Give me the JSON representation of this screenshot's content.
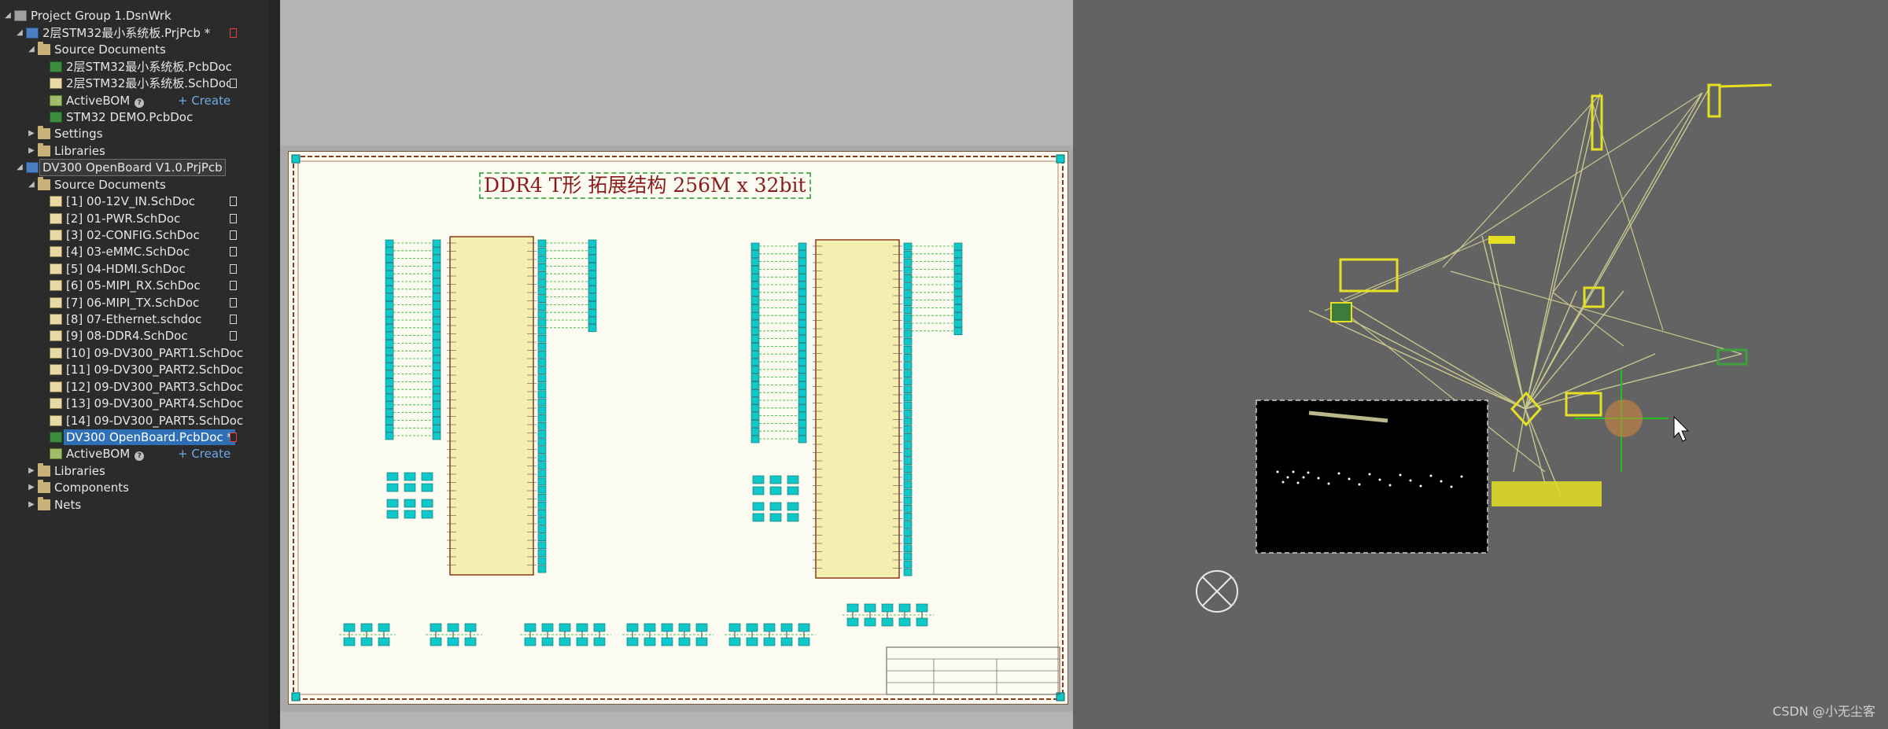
{
  "project_tree": {
    "items": [
      {
        "label": "Project Group 1.DsnWrk",
        "level": 0,
        "icon": "project-group-icon",
        "expanded": true
      },
      {
        "label": "2层STM32最小系统板.PrjPcb *",
        "level": 1,
        "icon": "pcb-project-icon",
        "expanded": true,
        "mark": "red"
      },
      {
        "label": "Source Documents",
        "level": 2,
        "icon": "folder-icon",
        "expanded": true
      },
      {
        "label": "2层STM32最小系统板.PcbDoc",
        "level": 3,
        "icon": "pcb-document-icon"
      },
      {
        "label": "2层STM32最小系统板.SchDoc",
        "level": 3,
        "icon": "schematic-document-icon",
        "mark": "doc"
      },
      {
        "label": "ActiveBOM",
        "level": 3,
        "icon": "bom-icon",
        "help": true,
        "create": "+ Create"
      },
      {
        "label": "STM32 DEMO.PcbDoc",
        "level": 3,
        "icon": "pcb-document-icon"
      },
      {
        "label": "Settings",
        "level": 2,
        "icon": "folder-icon",
        "expanded": false
      },
      {
        "label": "Libraries",
        "level": 2,
        "icon": "folder-icon",
        "expanded": false
      },
      {
        "label": "DV300 OpenBoard V1.0.PrjPcb",
        "level": 1,
        "icon": "pcb-project-icon",
        "expanded": true,
        "active": true
      },
      {
        "label": "Source Documents",
        "level": 2,
        "icon": "folder-icon",
        "expanded": true
      },
      {
        "label": "[1] 00-12V_IN.SchDoc",
        "level": 3,
        "icon": "schematic-document-icon",
        "mark": "doc"
      },
      {
        "label": "[2] 01-PWR.SchDoc",
        "level": 3,
        "icon": "schematic-document-icon",
        "mark": "doc"
      },
      {
        "label": "[3] 02-CONFIG.SchDoc",
        "level": 3,
        "icon": "schematic-document-icon",
        "mark": "doc"
      },
      {
        "label": "[4] 03-eMMC.SchDoc",
        "level": 3,
        "icon": "schematic-document-icon",
        "mark": "doc"
      },
      {
        "label": "[5] 04-HDMI.SchDoc",
        "level": 3,
        "icon": "schematic-document-icon",
        "mark": "doc"
      },
      {
        "label": "[6] 05-MIPI_RX.SchDoc",
        "level": 3,
        "icon": "schematic-document-icon",
        "mark": "doc"
      },
      {
        "label": "[7] 06-MIPI_TX.SchDoc",
        "level": 3,
        "icon": "schematic-document-icon",
        "mark": "doc"
      },
      {
        "label": "[8] 07-Ethernet.schdoc",
        "level": 3,
        "icon": "schematic-document-icon",
        "mark": "doc"
      },
      {
        "label": "[9] 08-DDR4.SchDoc",
        "level": 3,
        "icon": "schematic-document-icon",
        "mark": "doc"
      },
      {
        "label": "[10] 09-DV300_PART1.SchDoc",
        "level": 3,
        "icon": "schematic-document-icon"
      },
      {
        "label": "[11] 09-DV300_PART2.SchDoc",
        "level": 3,
        "icon": "schematic-document-icon"
      },
      {
        "label": "[12] 09-DV300_PART3.SchDoc",
        "level": 3,
        "icon": "schematic-document-icon"
      },
      {
        "label": "[13] 09-DV300_PART4.SchDoc",
        "level": 3,
        "icon": "schematic-document-icon"
      },
      {
        "label": "[14] 09-DV300_PART5.SchDoc",
        "level": 3,
        "icon": "schematic-document-icon"
      },
      {
        "label": "DV300 OpenBoard.PcbDoc *",
        "level": 3,
        "icon": "pcb-document-icon",
        "selected": true,
        "mark": "red"
      },
      {
        "label": "ActiveBOM",
        "level": 3,
        "icon": "bom-icon",
        "help": true,
        "create": "+ Create"
      },
      {
        "label": "Libraries",
        "level": 2,
        "icon": "folder-icon",
        "expanded": false
      },
      {
        "label": "Components",
        "level": 2,
        "icon": "folder-icon",
        "expanded": false
      },
      {
        "label": "Nets",
        "level": 2,
        "icon": "folder-icon",
        "expanded": false
      }
    ]
  },
  "schematic": {
    "title": "DDR4 T形 拓展结构 256M x 32bit"
  },
  "watermark": "CSDN @小无尘客",
  "colors": {
    "pin_cyan": "#10c8c8",
    "ic_body": "#f4eeb0",
    "net_green": "#2fae2f",
    "ratsnest": "#c9c88e",
    "component_yellow": "#e5e024"
  }
}
